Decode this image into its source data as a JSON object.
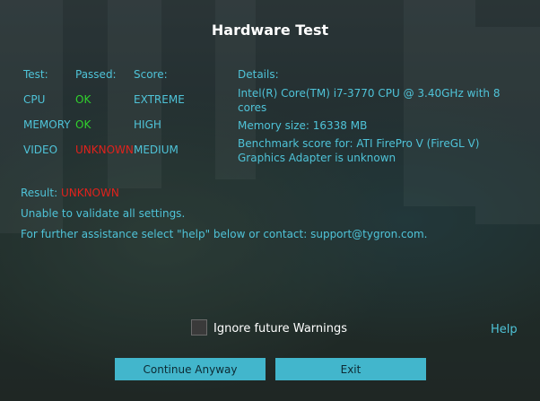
{
  "window": {
    "title": "Hardware Test"
  },
  "table": {
    "headers": {
      "test": "Test:",
      "passed": "Passed:",
      "score": "Score:",
      "details": "Details:"
    },
    "rows": [
      {
        "test": "CPU",
        "passed": "OK",
        "score": "EXTREME",
        "details": "Intel(R) Core(TM) i7-3770 CPU @ 3.40GHz with 8 cores"
      },
      {
        "test": "MEMORY",
        "passed": "OK",
        "score": "HIGH",
        "details": "Memory size: 16338 MB"
      },
      {
        "test": "VIDEO",
        "passed": "UNKNOWN",
        "score": "MEDIUM",
        "details": "Benchmark score for: ATI FirePro V (FireGL V) Graphics Adapter is unknown"
      }
    ]
  },
  "result": {
    "label": "Result:",
    "value": "UNKNOWN",
    "message1": "Unable to validate all settings.",
    "message2": "For further assistance select \"help\" below or contact: support@tygron.com."
  },
  "footer": {
    "ignore_label": "Ignore future Warnings",
    "ignore_checked": false,
    "help_label": "Help",
    "continue_label": "Continue Anyway",
    "exit_label": "Exit"
  },
  "colors": {
    "accent": "#4fc3d8",
    "ok": "#31d22d",
    "fail": "#e1221c",
    "button": "#42b6cc"
  }
}
